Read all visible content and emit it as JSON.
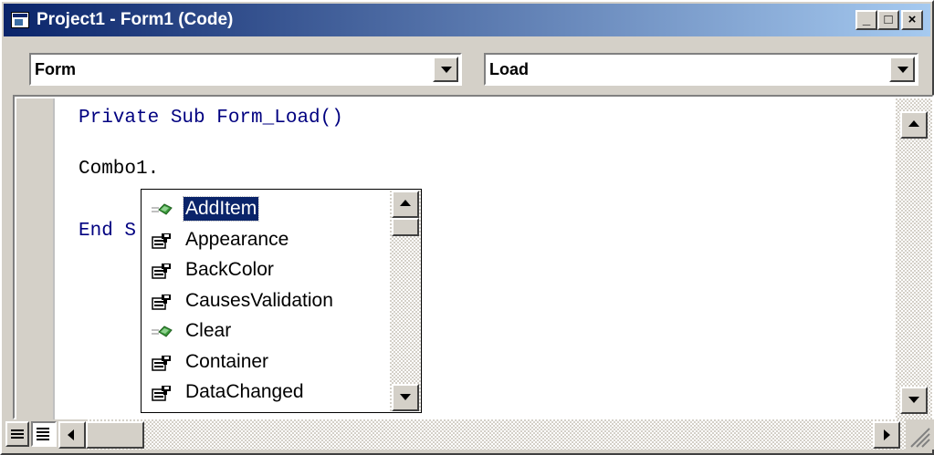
{
  "window": {
    "title": "Project1 - Form1 (Code)",
    "controls": {
      "minimize": "_",
      "maximize": "□",
      "close": "×"
    }
  },
  "object_combo": {
    "value": "Form"
  },
  "procedure_combo": {
    "value": "Load"
  },
  "code": {
    "line1_keyword": "Private Sub",
    "line1_rest": " Form_Load()",
    "line2": "Combo1.",
    "line3_keyword": "End S"
  },
  "autocomplete": {
    "items": [
      {
        "label": "AddItem",
        "icon": "method-icon",
        "selected": true
      },
      {
        "label": "Appearance",
        "icon": "property-icon",
        "selected": false
      },
      {
        "label": "BackColor",
        "icon": "property-icon",
        "selected": false
      },
      {
        "label": "CausesValidation",
        "icon": "property-icon",
        "selected": false
      },
      {
        "label": "Clear",
        "icon": "method-icon",
        "selected": false
      },
      {
        "label": "Container",
        "icon": "property-icon",
        "selected": false
      },
      {
        "label": "DataChanged",
        "icon": "property-icon",
        "selected": false
      }
    ]
  },
  "colors": {
    "titlebar_start": "#0a246a",
    "titlebar_end": "#a6caf0",
    "keyword": "#000080",
    "selection": "#0a246a",
    "chrome": "#d4d0c8"
  }
}
